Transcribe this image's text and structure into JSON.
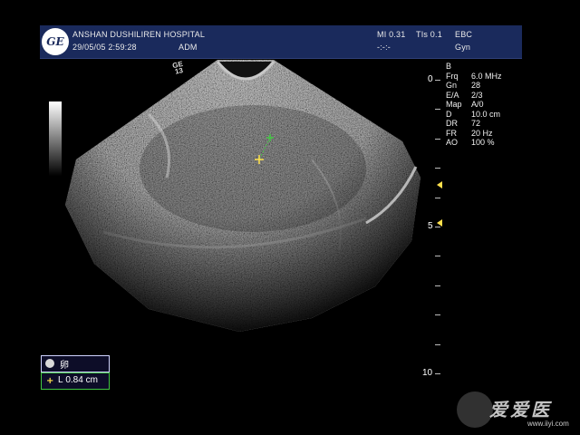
{
  "header": {
    "logo_text": "GE",
    "hospital": "ANSHAN DUSHILIREN HOSPITAL",
    "datetime": "29/05/05 2:59:28",
    "mode": "ADM",
    "mi": "MI 0.31",
    "tis": "TIs 0.1",
    "mi_subline": "-:-:-",
    "preset_top": "EBC",
    "preset_bottom": "Gyn"
  },
  "probe_mark": [
    "GE",
    "13"
  ],
  "parameters": {
    "mode": "B",
    "rows": [
      {
        "name": "Frq",
        "value": "6.0 MHz"
      },
      {
        "name": "Gn",
        "value": "28"
      },
      {
        "name": "E/A",
        "value": "2/3"
      },
      {
        "name": "Map",
        "value": "A/0"
      },
      {
        "name": "D",
        "value": "10.0 cm"
      },
      {
        "name": "DR",
        "value": "72"
      },
      {
        "name": "FR",
        "value": "20 Hz"
      },
      {
        "name": "AO",
        "value": "100 %"
      }
    ]
  },
  "depth_scale": {
    "labels": [
      "0",
      "5",
      "10"
    ],
    "unit_max": 10
  },
  "marker_box": {
    "label": "卵"
  },
  "measurement": {
    "label": "L",
    "value": "0.84 cm"
  },
  "watermark": {
    "chars": "爱爱医",
    "url": "www.iiyi.com"
  },
  "colors": {
    "header_bg": "#1a2a5c",
    "caliper_green": "#42c842",
    "caliper_yellow": "#ffe14d",
    "focus_marker": "#ffe14d"
  }
}
